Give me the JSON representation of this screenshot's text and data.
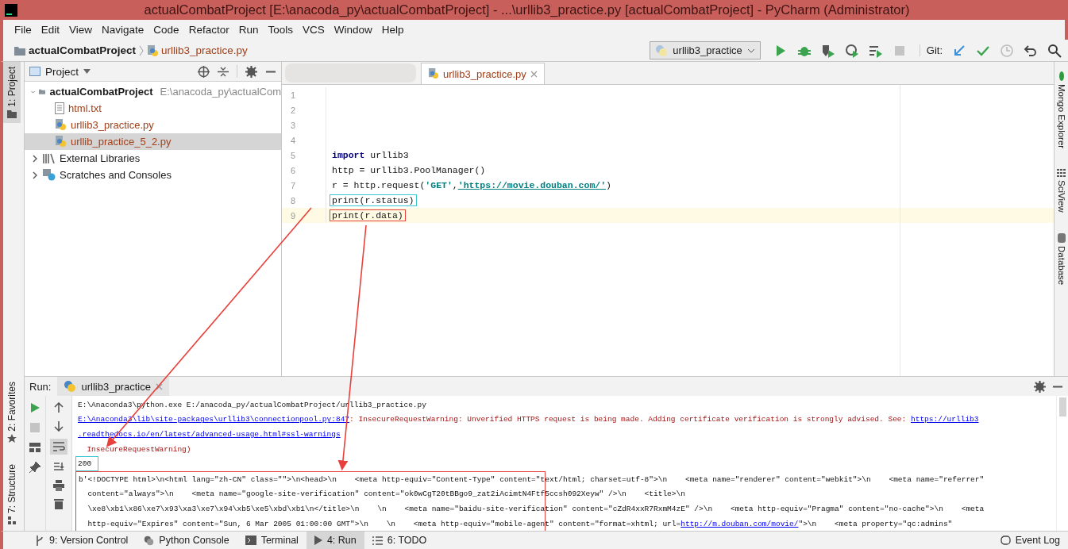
{
  "window": {
    "title": "actualCombatProject [E:\\anacoda_py\\actualCombatProject] - ...\\urllib3_practice.py [actualCombatProject] - PyCharm (Administrator)"
  },
  "menu": [
    "File",
    "Edit",
    "View",
    "Navigate",
    "Code",
    "Refactor",
    "Run",
    "Tools",
    "VCS",
    "Window",
    "Help"
  ],
  "breadcrumb": [
    {
      "label": "actualCombatProject",
      "kind": "folder"
    },
    {
      "label": "urllib3_practice.py",
      "kind": "file"
    }
  ],
  "toolbar": {
    "run_config": "urllib3_practice",
    "git_label": "Git:",
    "actions": [
      {
        "kind": "run",
        "disabled": false
      },
      {
        "kind": "debug",
        "disabled": false
      },
      {
        "kind": "coverage",
        "disabled": false
      },
      {
        "kind": "profile",
        "disabled": false
      },
      {
        "kind": "concurrency",
        "disabled": false
      },
      {
        "kind": "stop",
        "disabled": true
      }
    ],
    "git_actions": [
      {
        "kind": "update",
        "disabled": false
      },
      {
        "kind": "commit",
        "disabled": false
      },
      {
        "kind": "history",
        "disabled": true
      },
      {
        "kind": "revert",
        "disabled": false
      }
    ]
  },
  "left_tabs": [
    {
      "label": "1: Project",
      "kind": "folder",
      "selected": true
    },
    {
      "label": "2: Favorites",
      "kind": "star",
      "selected": false
    },
    {
      "label": "7: Structure",
      "kind": "structure",
      "selected": false
    }
  ],
  "right_tabs": [
    {
      "label": "Mongo Explorer",
      "kind": "leaf"
    },
    {
      "label": "SciView",
      "kind": "grid"
    },
    {
      "label": "Database",
      "kind": "database"
    }
  ],
  "project": {
    "title": "Project",
    "tree": [
      {
        "label": "actualCombatProject",
        "path": "E:\\anacoda_py\\actualCom",
        "kind": "folder",
        "expanded": true,
        "selected": false,
        "children": [
          {
            "label": "html.txt",
            "kind": "text",
            "selected": false,
            "color": "#a0401a"
          },
          {
            "label": "urllib3_practice.py",
            "kind": "python",
            "selected": false,
            "color": "#a0401a"
          },
          {
            "label": "urllib_practice_5_2.py",
            "kind": "python",
            "selected": true,
            "color": "#a0401a"
          }
        ]
      },
      {
        "label": "External Libraries",
        "kind": "library",
        "expanded": false,
        "selected": false
      },
      {
        "label": "Scratches and Consoles",
        "kind": "scratch",
        "expanded": false,
        "selected": false
      }
    ]
  },
  "editor": {
    "tabs": [
      {
        "label": "urllib3_practice.py",
        "selected": true
      }
    ],
    "lines": [
      {
        "number": "1",
        "current": false
      },
      {
        "number": "2",
        "current": false
      },
      {
        "number": "3",
        "current": false
      },
      {
        "number": "4",
        "current": false
      },
      {
        "number": "5",
        "current": false,
        "code": [
          {
            "text": "import",
            "kind": "keyword"
          },
          {
            "text": " urllib3",
            "kind": "plain"
          }
        ]
      },
      {
        "number": "6",
        "current": false,
        "code": [
          {
            "text": "http = urllib3.PoolManager()",
            "kind": "plain"
          }
        ]
      },
      {
        "number": "7",
        "current": false,
        "code": [
          {
            "text": "r = http.request(",
            "kind": "plain"
          },
          {
            "text": "'GET'",
            "kind": "string"
          },
          {
            "text": ",",
            "kind": "plain"
          },
          {
            "text": "'https://movie.douban.com/'",
            "kind": "url"
          },
          {
            "text": ")",
            "kind": "plain"
          }
        ]
      },
      {
        "number": "8",
        "current": false,
        "color": "#38c6d4",
        "code": [
          {
            "text": "print(r.status)",
            "kind": "plain"
          }
        ]
      },
      {
        "number": "9",
        "current": true,
        "color": "#e8403a",
        "code": [
          {
            "text": "print(r.data)",
            "kind": "plain"
          }
        ]
      }
    ]
  },
  "run": {
    "label": "Run:",
    "tab": "urllib3_practice",
    "lines": [
      {
        "segments": [
          {
            "text": "E:\\Anaconda3\\python.exe E:/anacoda_py/actualCombatProject/urllib3_practice.py",
            "kind": "plain"
          }
        ]
      },
      {
        "segments": [
          {
            "text": "E:\\Anaconda3\\lib\\site-packages\\urllib3\\connectionpool.py:847",
            "kind": "link"
          },
          {
            "text": ": InsecureRequestWarning: Unverified HTTPS request is being made. Adding certificate verification is strongly advised. See: ",
            "kind": "warning"
          },
          {
            "text": "https://urllib3",
            "kind": "link"
          }
        ]
      },
      {
        "segments": [
          {
            "text": " .readthedocs.io/en/latest/advanced-usage.html#ssl-warnings",
            "kind": "link"
          }
        ]
      },
      {
        "segments": [
          {
            "text": "  InsecureRequestWarning)",
            "kind": "warning"
          }
        ]
      },
      {
        "color": "#38c6d4",
        "segments": [
          {
            "text": "200",
            "kind": "plain"
          }
        ]
      }
    ],
    "output_box": {
      "color": "#e8403a",
      "lines": [
        {
          "segments": [
            {
              "text": "b'<!DOCTYPE html>\\n<html lang=\"zh-CN\" class=\"\">\\n<head>\\n    <meta http-equiv=\"Content-Type\" content=\"text/html; charset=utf-8\">\\n    <meta name=\"renderer\" content=\"webkit\">\\n    <meta name=\"referrer\"",
              "kind": "plain"
            }
          ]
        },
        {
          "segments": [
            {
              "text": "  content=\"always\">\\n    <meta name=\"google-site-verification\" content=\"ok0wCgT20tBBgo9_zat2iAcimtN4Ftf5ccsh092Xeyw\" />\\n    <title>\\n",
              "kind": "plain"
            }
          ]
        },
        {
          "segments": [
            {
              "text": "  \\xe8\\xb1\\x86\\xe7\\x93\\xa3\\xe7\\x94\\xb5\\xe5\\xbd\\xb1\\n</title>\\n    \\n    <meta name=\"baidu-site-verification\" content=\"cZdR4xxR7RxmM4zE\" />\\n    <meta http-equiv=\"Pragma\" content=\"no-cache\">\\n    <meta",
              "kind": "plain"
            }
          ]
        },
        {
          "segments": [
            {
              "text": "  http-equiv=\"Expires\" content=\"Sun, 6 Mar 2005 01:00:00 GMT\">\\n    \\n    <meta http-equiv=\"mobile-agent\" content=\"format=xhtml; url=",
              "kind": "plain"
            },
            {
              "text": "http://m.douban.com/movie/",
              "kind": "link"
            },
            {
              "text": "\">\\n    <meta property=\"qc:admins\"",
              "kind": "plain"
            }
          ]
        }
      ]
    }
  },
  "status_bar": {
    "tabs": [
      {
        "label": "9: Version Control",
        "kind": "vcs",
        "selected": false
      },
      {
        "label": "Python Console",
        "kind": "python",
        "selected": false
      },
      {
        "label": "Terminal",
        "kind": "terminal",
        "selected": false
      },
      {
        "label": "4: Run",
        "kind": "run",
        "selected": true
      },
      {
        "label": "6: TODO",
        "kind": "todo",
        "selected": false
      }
    ],
    "event_log": "Event Log"
  }
}
